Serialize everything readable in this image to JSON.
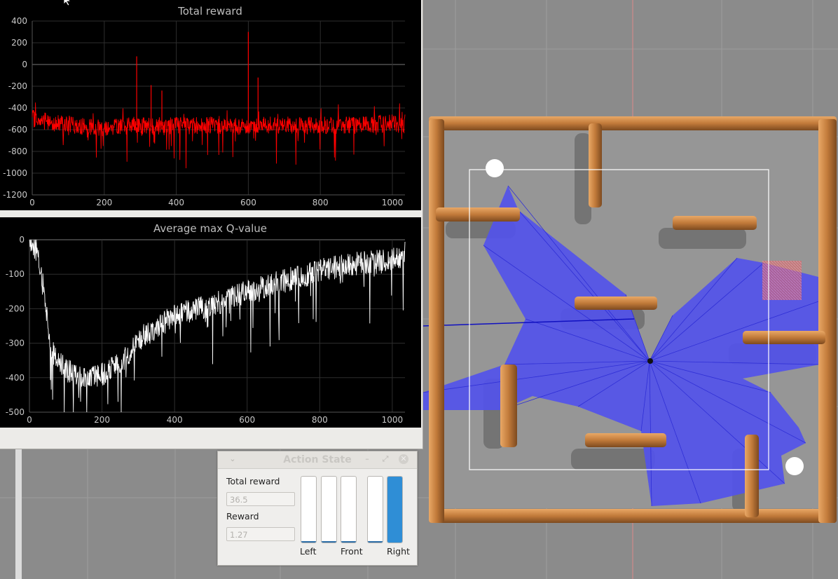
{
  "reward_plot": {
    "title": "Total reward",
    "y_ticks": [
      "400",
      "200",
      "0",
      "-200",
      "-400",
      "-600",
      "-800",
      "-1000",
      "-1200"
    ],
    "x_ticks": [
      "0",
      "200",
      "400",
      "600",
      "800",
      "1000"
    ]
  },
  "q_plot": {
    "title": "Average max Q-value",
    "y_ticks": [
      "0",
      "-100",
      "-200",
      "-300",
      "-400",
      "-500"
    ],
    "x_ticks": [
      "0",
      "200",
      "400",
      "600",
      "800",
      "1000"
    ]
  },
  "chart_data": [
    {
      "type": "line",
      "title": "Total reward",
      "x_range": [
        0,
        1035
      ],
      "ylim": [
        -1200,
        400
      ],
      "series": [
        {
          "color": "#ff0000",
          "baseline_mean": -560,
          "x": [
            0,
            100,
            200,
            280,
            290,
            320,
            400,
            500,
            600,
            640,
            700,
            800,
            900,
            1000,
            1035
          ],
          "values": [
            -500,
            -560,
            -580,
            -560,
            -560,
            -570,
            -560,
            -560,
            -570,
            -560,
            -560,
            -560,
            -560,
            -540,
            -560
          ]
        }
      ],
      "spikes": [
        {
          "x": 290,
          "y": 75
        },
        {
          "x": 600,
          "y": 300
        },
        {
          "x": 330,
          "y": -190
        },
        {
          "x": 360,
          "y": -240
        },
        {
          "x": 627,
          "y": -120
        }
      ],
      "grid": true
    },
    {
      "type": "line",
      "title": "Average max Q-value",
      "x_range": [
        0,
        1035
      ],
      "ylim": [
        -500,
        0
      ],
      "series": [
        {
          "color": "#ffffff",
          "x": [
            0,
            20,
            40,
            60,
            100,
            150,
            200,
            260,
            300,
            400,
            500,
            600,
            700,
            800,
            900,
            1000,
            1035
          ],
          "values": [
            0,
            -30,
            -150,
            -320,
            -380,
            -400,
            -390,
            -350,
            -290,
            -220,
            -190,
            -150,
            -120,
            -90,
            -70,
            -60,
            -40
          ]
        }
      ],
      "grid": true
    }
  ],
  "action_state": {
    "title": "Action State",
    "total_reward_label": "Total reward",
    "total_reward_value": "36.5",
    "reward_label": "Reward",
    "reward_value": "1.27",
    "bars": [
      {
        "label": "Left",
        "level": 0.0
      },
      {
        "label": "",
        "level": 0.0
      },
      {
        "label": "Front",
        "level": 0.0
      },
      {
        "label": "",
        "level": 0.0
      },
      {
        "label": "Right",
        "level": 1.0
      }
    ],
    "bar_color": "#2f8ed6"
  },
  "colors": {
    "floor": "#8b8b8b",
    "wood": "#c4823f",
    "laser": "#5050ee",
    "goal_marker": "#ff6a6a"
  }
}
